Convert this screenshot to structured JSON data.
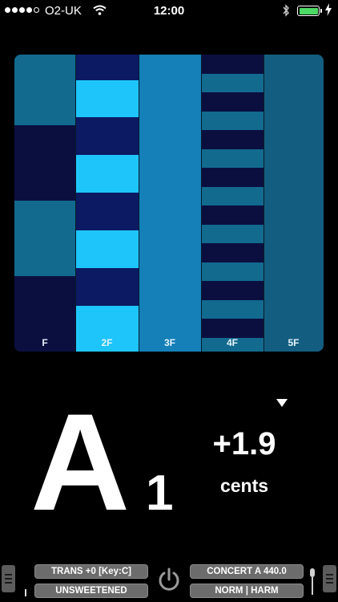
{
  "status_bar": {
    "carrier": "O2-UK",
    "time": "12:00",
    "signal_bars_filled": 4,
    "signal_bars_total": 5,
    "battery_level": 1.0
  },
  "spectrum": {
    "columns": [
      {
        "label": "F"
      },
      {
        "label": "2F"
      },
      {
        "label": "3F"
      },
      {
        "label": "4F"
      },
      {
        "label": "5F"
      }
    ],
    "colors": {
      "dark": "#0b0f40",
      "bright": "#1ec5fb",
      "mid": "#126a8f",
      "third": "#157fb8",
      "fifth": "#135e80"
    }
  },
  "tuner": {
    "note": "A",
    "octave": "1",
    "cents_value": "+1.9",
    "cents_unit": "cents"
  },
  "toolbar": {
    "transpose_label": "TRANS +0 [Key:C]",
    "temperament_label": "UNSWEETENED",
    "concert_label": "CONCERT A 440.0",
    "mode_label": "NORM | HARM"
  },
  "icons": [
    "signal-icon",
    "wifi-icon",
    "bluetooth-icon",
    "battery-icon",
    "charging-icon",
    "dropdown-triangle-icon",
    "menu-icon",
    "power-icon",
    "microphone-icon"
  ]
}
